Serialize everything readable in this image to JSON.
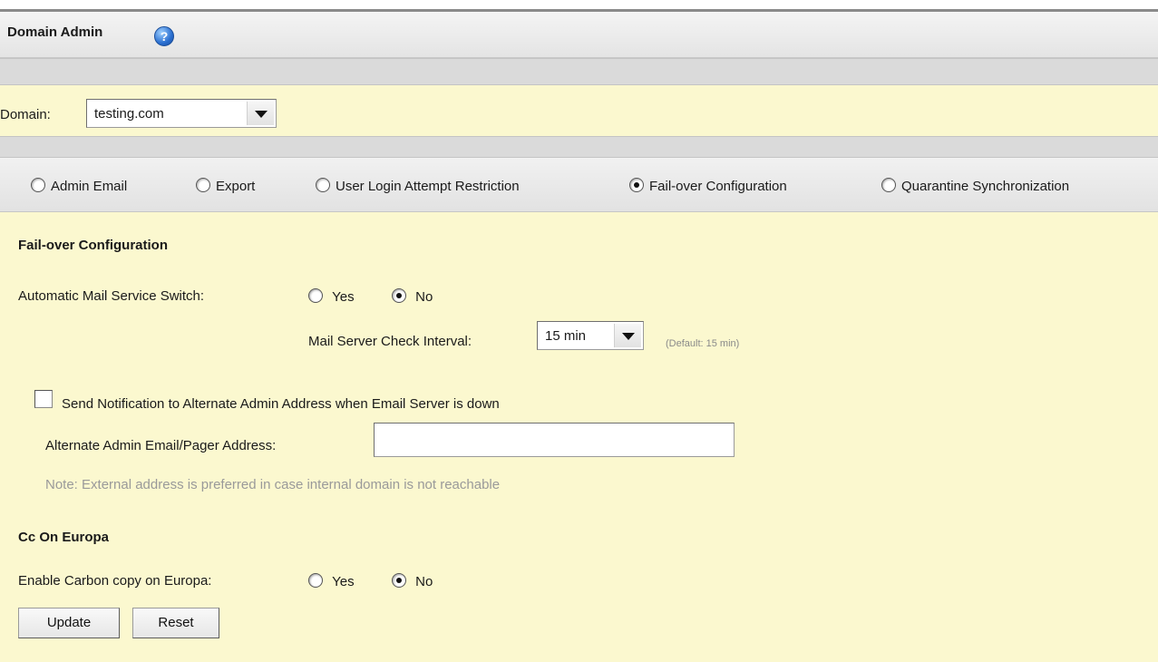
{
  "header": {
    "title": "Domain Admin",
    "help_icon": "help-icon",
    "help_glyph": "?"
  },
  "domain": {
    "label": "Domain:",
    "selected": "testing.com"
  },
  "tabs": [
    {
      "label": "Admin Email",
      "checked": false
    },
    {
      "label": "Export",
      "checked": false
    },
    {
      "label": "User Login Attempt Restriction",
      "checked": false
    },
    {
      "label": "Fail-over Configuration",
      "checked": true
    },
    {
      "label": "Quarantine Synchronization",
      "checked": false
    }
  ],
  "failover": {
    "section_title": "Fail-over Configuration",
    "auto_switch_label": "Automatic Mail Service Switch:",
    "yes_label": "Yes",
    "no_label": "No",
    "selected": "No",
    "interval_label": "Mail Server Check Interval:",
    "interval_value": "15 min",
    "interval_hint": "(Default: 15 min)",
    "notify_label": "Send Notification to Alternate Admin Address when Email Server is down",
    "notify_checked": false,
    "alt_address_label": "Alternate Admin Email/Pager Address:",
    "alt_address_value": "",
    "note": "Note: External address is preferred in case internal domain is not reachable"
  },
  "cc": {
    "section_title": "Cc On Europa",
    "enable_label": "Enable Carbon copy on Europa:",
    "yes_label": "Yes",
    "no_label": "No",
    "selected": "No"
  },
  "buttons": {
    "update": "Update",
    "reset": "Reset"
  }
}
